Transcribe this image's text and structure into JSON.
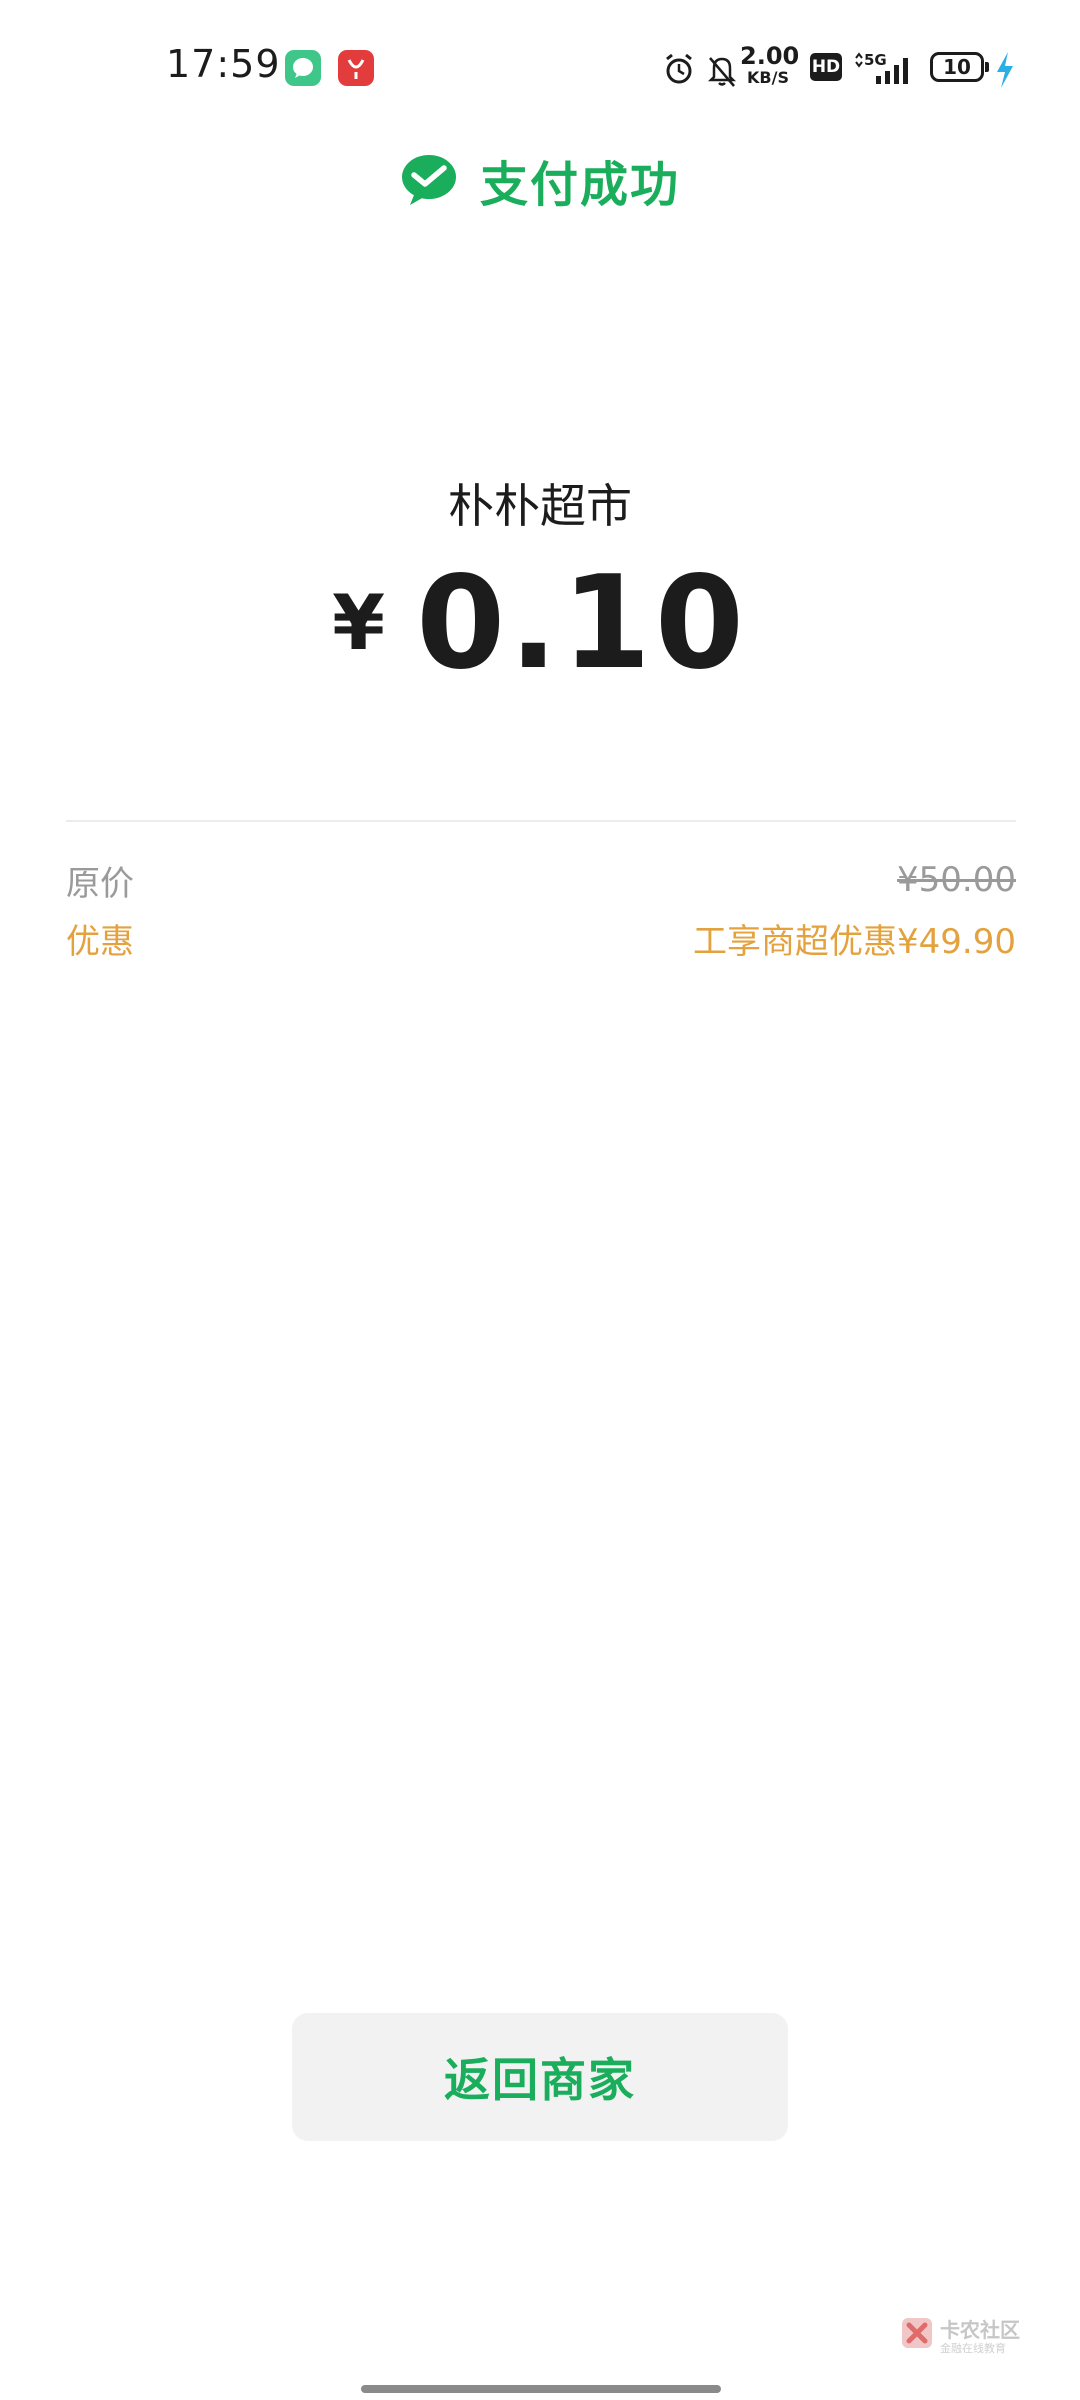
{
  "status_bar": {
    "time": "17:59",
    "notifications": [
      "chat-app-icon",
      "shopping-app-icon"
    ],
    "network_speed_value": "2.00",
    "network_speed_unit": "KB/S",
    "hd_label": "HD",
    "signal_label": "5G",
    "battery_level": "10"
  },
  "header": {
    "title": "支付成功",
    "accent_color": "#1aad5b"
  },
  "payment": {
    "merchant": "朴朴超市",
    "currency_symbol": "¥",
    "amount": "0.10"
  },
  "details": {
    "original_label": "原价",
    "original_value": "¥50.00",
    "discount_label": "优惠",
    "discount_value": "工享商超优惠¥49.90",
    "discount_color": "#e4a23e"
  },
  "actions": {
    "back_label": "返回商家"
  },
  "watermark": {
    "text": "卡农社区",
    "subtext": "金融在线教育"
  }
}
